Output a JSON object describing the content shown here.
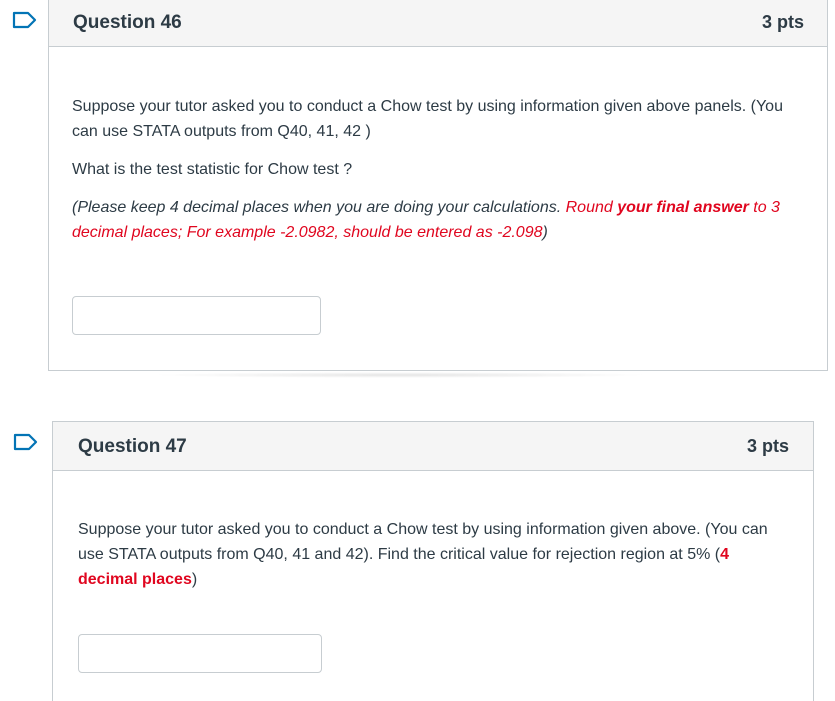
{
  "questions": [
    {
      "title": "Question 46",
      "points": "3 pts",
      "p1": "Suppose your tutor asked you to conduct a Chow test by using information given above panels. (You can use STATA outputs from Q40, 41, 42 )",
      "p2": "What is the  test statistic for Chow test ?",
      "p3": {
        "a": "(Please keep 4 decimal places when you are doing your calculations. ",
        "b": "Round ",
        "c": "your final answer",
        "d": " to  3 decimal places; For example -2.0982, should be entered as -2.098",
        "e": ")"
      },
      "answer_value": ""
    },
    {
      "title": "Question 47",
      "points": "3 pts",
      "p1a": "Suppose your tutor asked you to conduct a Chow test by using information given above.  (You can use STATA outputs from Q40, 41 and 42).  Find the critical value for rejection region  at 5% (",
      "p1b": "4 decimal places",
      "p1c": ")",
      "answer_value": ""
    }
  ],
  "colors": {
    "flag": "#0374b5",
    "emphasis": "#e0061f",
    "border": "#c7cdd1",
    "header_bg": "#f5f5f5"
  },
  "icons": [
    "flag-icon",
    "flag-icon"
  ]
}
